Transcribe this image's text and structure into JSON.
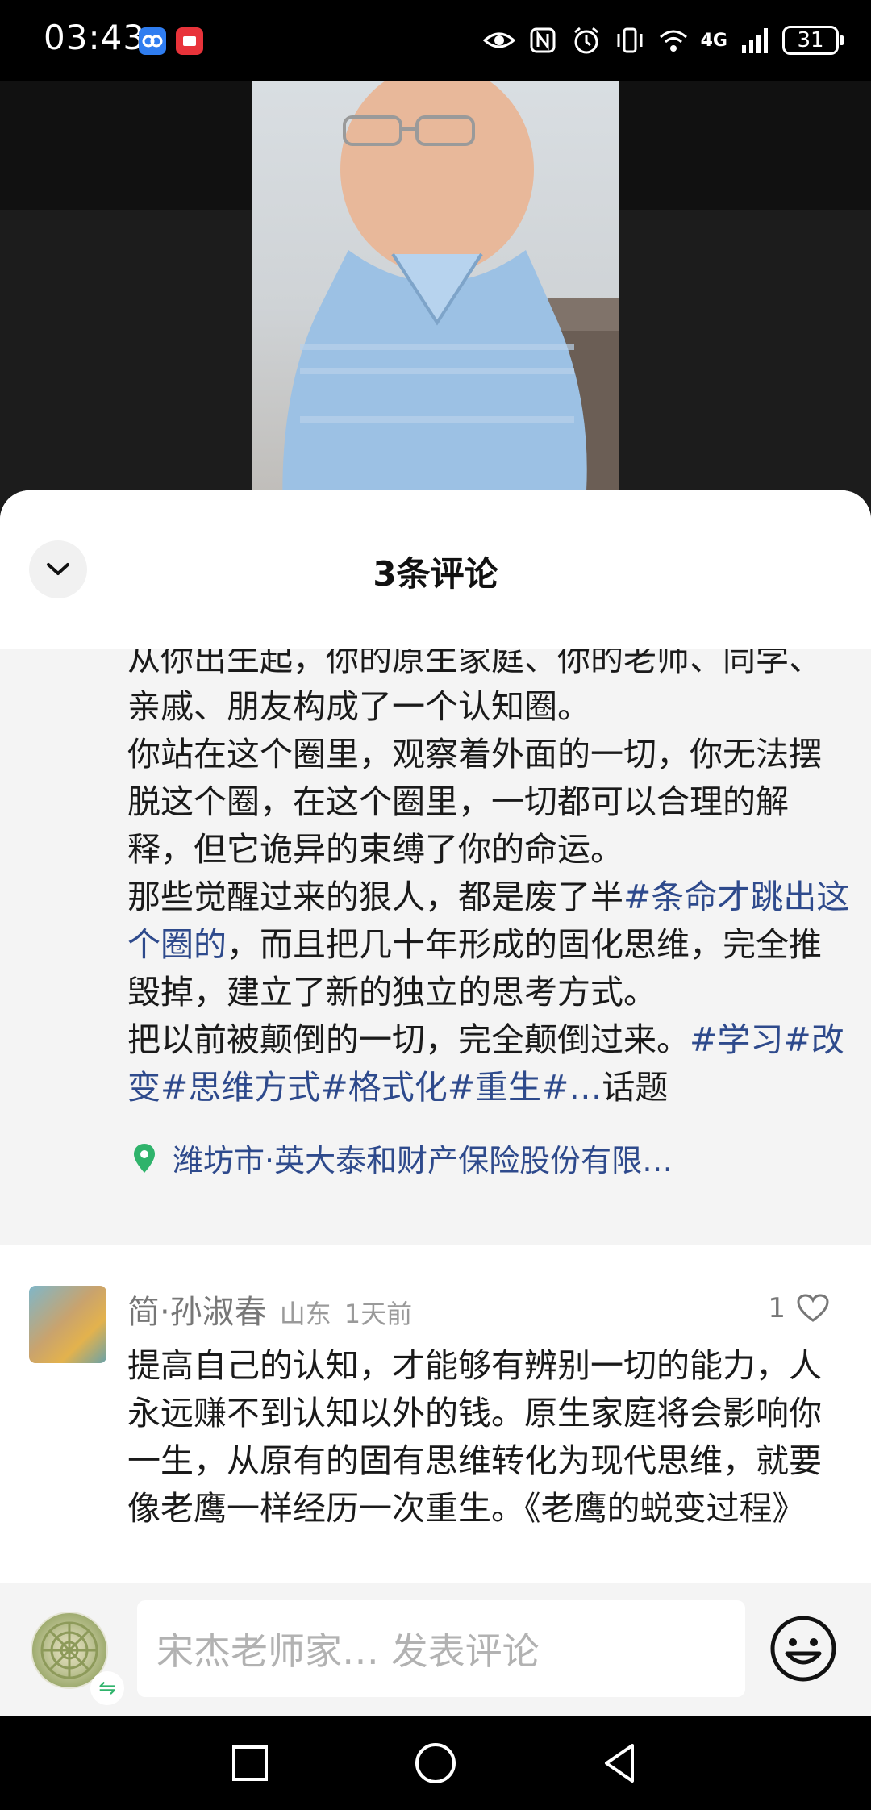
{
  "status_bar": {
    "time": "03:43",
    "network": "4G",
    "battery": "31",
    "icons": [
      "app-blue-icon",
      "app-red-icon",
      "eye-icon",
      "nfc-icon",
      "alarm-icon",
      "vibrate-icon",
      "wifi-icon",
      "signal-icon",
      "battery-icon"
    ]
  },
  "sheet": {
    "title": "3条评论"
  },
  "post": {
    "paragraphs": [
      {
        "segments": [
          {
            "text": "从你出生起，你的原生家庭、你的老师、同学、亲戚、朋友构成了一个认知圈。",
            "tag": false
          }
        ]
      },
      {
        "segments": [
          {
            "text": "你站在这个圈里，观察着外面的一切，你无法摆脱这个圈，在这个圈里，一切都可以合理的解释，但它诡异的束缚了你的命运。",
            "tag": false
          }
        ]
      },
      {
        "segments": [
          {
            "text": "那些觉醒过来的狠人，都是废了半",
            "tag": false
          },
          {
            "text": "#条命才跳出这个圈的",
            "tag": true
          },
          {
            "text": "，而且把几十年形成的固化思维，完全推毁掉，建立了新的独立的思考方式。",
            "tag": false
          }
        ]
      },
      {
        "segments": [
          {
            "text": "把以前被颠倒的一切，完全颠倒过来。",
            "tag": false
          },
          {
            "text": "#学习#改变#思维方式#格式化#重生#…",
            "tag": true
          },
          {
            "text": "话题",
            "tag": false
          }
        ]
      }
    ],
    "location": "潍坊市·英大泰和财产保险股份有限…"
  },
  "comment": {
    "author": "简·孙淑春",
    "region": "山东",
    "time": "1天前",
    "likes": "1",
    "text": "提高自己的认知，才能够有辨别一切的能力，人永远赚不到认知以外的钱。原生家庭将会影响你一生，从原有的固有思维转化为现代思维，就要像老鹰一样经历一次重生。《老鹰的蜕变过程》"
  },
  "input_bar": {
    "placeholder": "宋杰老师家… 发表评论",
    "swap_symbol": "⇋"
  },
  "colors": {
    "hashtag": "#2e4a8c",
    "location_pin": "#2fb36b",
    "sheet_bg": "#ffffff",
    "post_bg": "#f4f4f4"
  }
}
